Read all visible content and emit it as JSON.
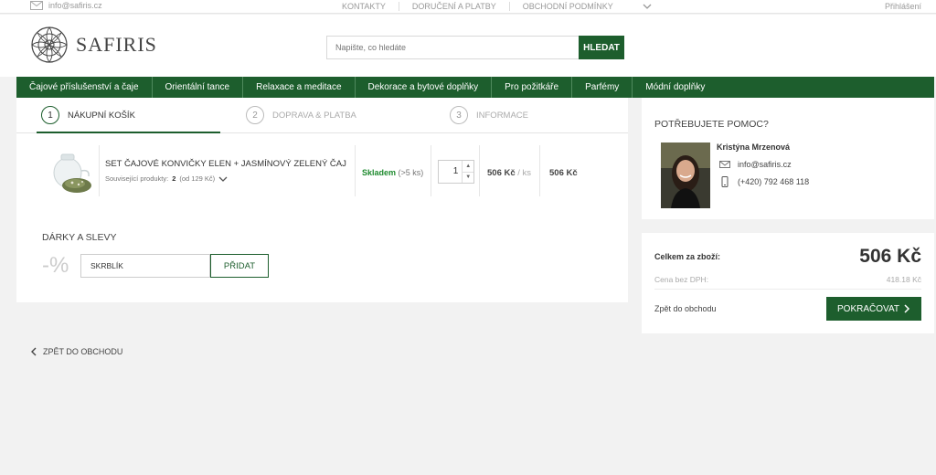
{
  "topbar": {
    "email": "info@safiris.cz",
    "links": [
      "KONTAKTY",
      "DORUČENÍ A PLATBY",
      "OBCHODNÍ PODMÍNKY"
    ],
    "login": "Přihlášení"
  },
  "header": {
    "brand": "SAFIRIS",
    "search_placeholder": "Napište, co hledáte",
    "search_button": "HLEDAT"
  },
  "nav": {
    "items": [
      "Čajové příslušenství a čaje",
      "Orientální tance",
      "Relaxace a meditace",
      "Dekorace a bytové doplňky",
      "Pro požitkáře",
      "Parfémy",
      "Módní doplňky"
    ]
  },
  "steps": [
    {
      "num": "1",
      "label": "NÁKUPNÍ KOŠÍK"
    },
    {
      "num": "2",
      "label": "DOPRAVA & PLATBA"
    },
    {
      "num": "3",
      "label": "INFORMACE"
    }
  ],
  "cart_item": {
    "name": "SET ČAJOVÉ KONVIČKY ELEN + JASMÍNOVÝ ZELENÝ ČAJ",
    "related_label": "Související produkty:",
    "related_count": "2",
    "related_price": "(od 129 Kč)",
    "stock_status": "Skladem",
    "stock_count": "(>5 ks)",
    "quantity": "1",
    "unit_price": "506 Kč",
    "unit_suffix": "/ ks",
    "total_price": "506 Kč"
  },
  "gifts": {
    "title": "DÁRKY A SLEVY",
    "percent_symbol": "-%",
    "coupon_value": "SKRBLÍK",
    "apply_button": "PŘIDAT"
  },
  "back_link": "ZPĚT DO OBCHODU",
  "help": {
    "title": "POTŘEBUJETE POMOC?",
    "contact_name": "Kristýna Mrzenová",
    "email": "info@safiris.cz",
    "phone": "(+420) 792 468 118"
  },
  "summary": {
    "total_label": "Celkem za zboží:",
    "total_value": "506 Kč",
    "vat_label": "Cena bez DPH:",
    "vat_value": "418.18 Kč",
    "back_label": "Zpět do obchodu",
    "continue_button": "POKRAČOVAT"
  },
  "colors": {
    "brand_green": "#1d5e2d",
    "stock_green": "#1e8a2e"
  }
}
